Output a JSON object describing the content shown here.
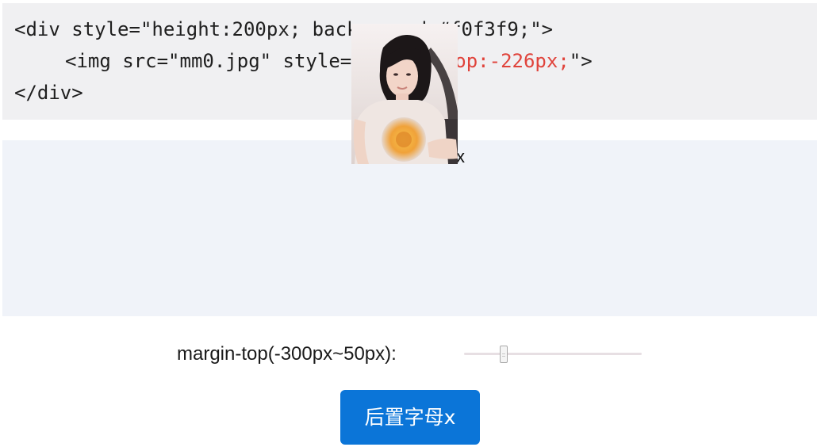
{
  "code": {
    "line1": "<div style=\"height:200px; background:#f0f3f9;\">",
    "line2_prefix": "<img src=\"mm0.jpg\" style=\"",
    "line2_red": "margin-top:-226px;",
    "line2_suffix": "\">",
    "line3": "</div>"
  },
  "demo": {
    "letter": "x"
  },
  "controls": {
    "margin_label": "margin-top(-300px~50px):",
    "slider_min": -300,
    "slider_max": 50,
    "slider_value": -226,
    "button_label": "后置字母x"
  },
  "colors": {
    "code_panel_bg": "#f0f0f2",
    "demo_bg": "#f0f3f9",
    "code_highlight": "#e0433b",
    "button_bg": "#0b75d8"
  }
}
